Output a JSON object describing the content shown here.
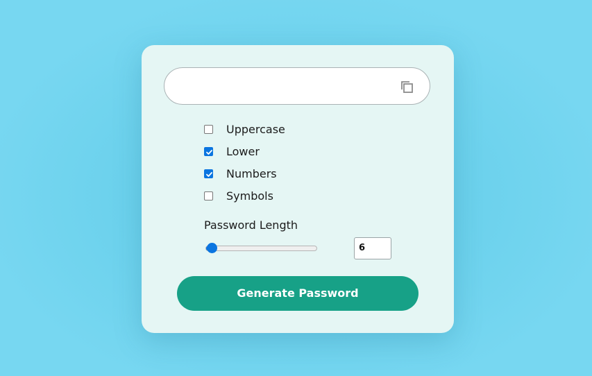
{
  "password_display": {
    "value": "",
    "placeholder": "",
    "copy_icon": "copy-icon"
  },
  "options": [
    {
      "label": "Uppercase",
      "checked": false
    },
    {
      "label": "Lower",
      "checked": true
    },
    {
      "label": "Numbers",
      "checked": true
    },
    {
      "label": "Symbols",
      "checked": false
    }
  ],
  "length": {
    "label": "Password Length",
    "value": "6",
    "slider_value": 6,
    "slider_fraction": 0.0
  },
  "generate_button": {
    "label": "Generate Password"
  },
  "colors": {
    "page_background": "#77d7f1",
    "card_background": "#e5f6f4",
    "accent": "#17a187",
    "checkbox_checked": "#0b75e0"
  }
}
